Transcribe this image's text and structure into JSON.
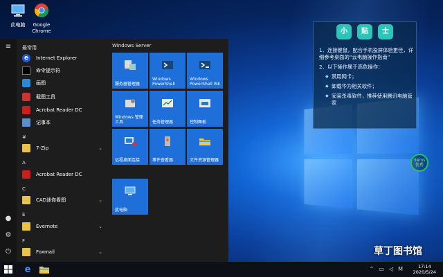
{
  "desktop": {
    "icons": [
      {
        "label": "此电脑",
        "icon": "computer-icon"
      },
      {
        "label": "Google\nChrome",
        "icon": "chrome-icon"
      }
    ]
  },
  "start_menu": {
    "recent_header": "最常用",
    "recent_apps": [
      {
        "label": "Internet Explorer",
        "icon": "ie-icon"
      },
      {
        "label": "命令提示符",
        "icon": "cmd-icon"
      },
      {
        "label": "画图",
        "icon": "paint-icon"
      },
      {
        "label": "截图工具",
        "icon": "snipping-icon"
      },
      {
        "label": "Acrobat Reader DC",
        "icon": "pdf-icon"
      },
      {
        "label": "记事本",
        "icon": "notepad-icon"
      }
    ],
    "groups": [
      {
        "header": "#",
        "apps": [
          {
            "label": "7-Zip",
            "icon": "folder-icon",
            "expandable": true
          }
        ]
      },
      {
        "header": "A",
        "apps": [
          {
            "label": "Acrobat Reader DC",
            "icon": "pdf-icon",
            "expandable": false
          }
        ]
      },
      {
        "header": "C",
        "apps": [
          {
            "label": "CAD迷你看图",
            "icon": "folder-icon",
            "expandable": true
          }
        ]
      },
      {
        "header": "E",
        "apps": [
          {
            "label": "Evernote",
            "icon": "folder-icon",
            "expandable": true
          }
        ]
      },
      {
        "header": "F",
        "apps": [
          {
            "label": "Foxmail",
            "icon": "folder-icon",
            "expandable": true
          }
        ]
      }
    ],
    "tiles_header": "Windows Server",
    "tiles": [
      {
        "label": "服务器管理器",
        "icon": "server-manager-icon"
      },
      {
        "label": "Windows\nPowerShell",
        "icon": "powershell-icon"
      },
      {
        "label": "Windows\nPowerShell ISE",
        "icon": "powershell-ise-icon"
      },
      {
        "label": "Windows 管理\n工具",
        "icon": "admin-tools-icon"
      },
      {
        "label": "任务管理器",
        "icon": "task-manager-icon"
      },
      {
        "label": "控制面板",
        "icon": "control-panel-icon"
      },
      {
        "label": "远程桌面连接",
        "icon": "remote-desktop-icon"
      },
      {
        "label": "事件查看器",
        "icon": "event-viewer-icon"
      },
      {
        "label": "文件资源管理器",
        "icon": "file-explorer-icon"
      },
      {
        "label": "此电脑",
        "icon": "this-pc-icon"
      }
    ]
  },
  "tip_panel": {
    "title_chars": [
      "小",
      "贴",
      "士"
    ],
    "item1": "1、连接键鼠，配合手机投屏体验更佳，详细参考桌面的“云电脑操作指南”",
    "item2": "2、以下操作属于高危操作：",
    "bullets": [
      "禁用网卡；",
      "卸载华为相关软件；",
      "安装杀毒软件，推荐使用腾讯电脑管家"
    ]
  },
  "ping": {
    "value": "34ms",
    "status": "优秀"
  },
  "watermark": "草丁图书馆",
  "taskbar": {
    "time": "17:14",
    "date": "2020/5/24",
    "ime": "M"
  },
  "colors": {
    "tile": "#1e6fd9",
    "accent": "#2fc4b8",
    "ping": "#22c55e"
  }
}
